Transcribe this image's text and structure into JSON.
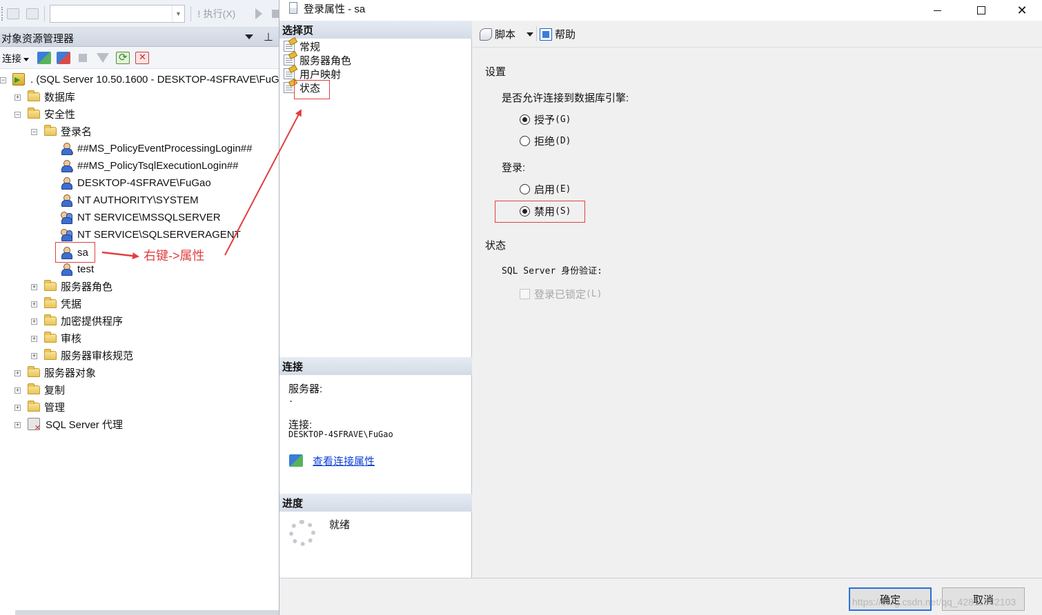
{
  "toolbar": {
    "execute_label": "执行(X)",
    "execute_prefix": "!"
  },
  "object_explorer": {
    "title": "对象资源管理器",
    "connect_label": "连接",
    "server_node": ". (SQL Server 10.50.1600 - DESKTOP-4SFRAVE\\FuGao)",
    "tree": {
      "databases": "数据库",
      "security": "安全性",
      "logins": "登录名",
      "login_items": [
        "##MS_PolicyEventProcessingLogin##",
        "##MS_PolicyTsqlExecutionLogin##",
        "DESKTOP-4SFRAVE\\FuGao",
        "NT AUTHORITY\\SYSTEM",
        "NT SERVICE\\MSSQLSERVER",
        "NT SERVICE\\SQLSERVERAGENT",
        "sa",
        "test"
      ],
      "server_roles": "服务器角色",
      "credentials": "凭据",
      "crypto_providers": "加密提供程序",
      "audits": "审核",
      "audit_specs": "服务器审核规范",
      "server_objects": "服务器对象",
      "replication": "复制",
      "management": "管理",
      "agent": "SQL Server 代理"
    }
  },
  "annotation": {
    "text": "右键->属性",
    "color": "#e0403f"
  },
  "dialog": {
    "title": "登录属性 - sa",
    "window_buttons": {
      "close": "✕"
    },
    "select_page": {
      "header": "选择页",
      "items": [
        "常规",
        "服务器角色",
        "用户映射",
        "状态"
      ]
    },
    "connection": {
      "header": "连接",
      "server_label": "服务器:",
      "server_value": ".",
      "connection_label": "连接:",
      "connection_value": "DESKTOP-4SFRAVE\\FuGao",
      "view_link": "查看连接属性"
    },
    "progress": {
      "header": "进度",
      "status": "就绪"
    },
    "content_toolbar": {
      "script": "脚本",
      "help": "帮助"
    },
    "settings": {
      "header": "设置",
      "allow_connect_label": "是否允许连接到数据库引擎:",
      "grant_label": "授予",
      "grant_key": "(G)",
      "deny_label": "拒绝",
      "deny_key": "(D)",
      "login_label": "登录:",
      "enable_label": "启用",
      "enable_key": "(E)",
      "disable_label": "禁用",
      "disable_key": "(S)"
    },
    "status": {
      "header": "状态",
      "auth_label": "SQL Server 身份验证:",
      "locked_label": "登录已锁定",
      "locked_key": "(L)"
    },
    "buttons": {
      "ok": "确定",
      "cancel": "取消"
    },
    "watermark": "https://blog.csdn.net/qq_42811842103"
  }
}
